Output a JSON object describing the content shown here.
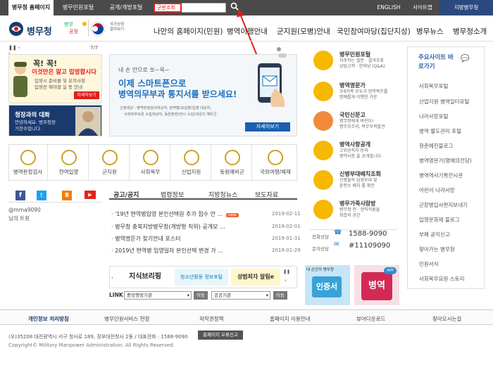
{
  "topbar": {
    "tabs": [
      "병무청 홈페이지",
      "병무민원포털",
      "공개/개방포털"
    ],
    "search_value": "군번조회",
    "links": [
      "ENGLISH",
      "사이트맵",
      "지방병무청"
    ]
  },
  "logo": {
    "text": "병무청",
    "slogan": "국가상징 알아보기"
  },
  "gnb": [
    "나만의 홈페이지(민원)",
    "병역이행안내",
    "군지원(모병)안내",
    "국민참여마당(집단지성)",
    "병무뉴스",
    "병무청소개"
  ],
  "left_slider": {
    "counter": "7/7",
    "title": "꼭! 꼭!",
    "headline": "이것만은 알고 입영합시다",
    "bullets": [
      "입영시 준비물 및 유의사항",
      "입영전 해야할 일 등 안내"
    ],
    "button": "자세히보기"
  },
  "chief": {
    "title": "청장과의 대화",
    "desc": "안녕하세요. 병무청장 기찬수입니다."
  },
  "main_banner": {
    "top": "내 손 안으로 쏘~옥~",
    "line1": "이제 스마트폰으로",
    "line2": "병역의무부과 통지서를 받으세요!",
    "note1": "신청대상 : 병역판정검사대상자, 현역병(모집병)입영 대상자,",
    "note2": "사회복무요원 소집대상자, 동원훈련(전시 소집)대상인 예비군",
    "button": "자세히보기"
  },
  "services": [
    "병역판정검사",
    "현역입영",
    "군지원",
    "사회복무",
    "산업지원",
    "동원예비군",
    "국외여행/체재"
  ],
  "social": {
    "handle": "@mma9090",
    "tweets": "님의 트윗"
  },
  "news": {
    "tabs": [
      "공고/공지",
      "법령정보",
      "지방청뉴스",
      "보도자료"
    ],
    "items": [
      {
        "title": "'19년 현역병입영 본인선택원 추가 접수 안 ...",
        "date": "2019-02-11",
        "is_new": "new"
      },
      {
        "title": "병무청 충북지방병무청(개방형 직위) 공개모 ...",
        "date": "2019-02-01",
        "is_new": ""
      },
      {
        "title": "병역명문가 찾기안내 포스터",
        "date": "2019-01-31",
        "is_new": ""
      },
      {
        "title": "2019년 현역병 입영일자 본인선택 변경 가 ...",
        "date": "2019-01-29",
        "is_new": ""
      }
    ]
  },
  "banners": [
    "지식브리핑",
    "청소년활동 정보포털",
    "성범죄자 알림e"
  ],
  "link_bar": {
    "label": "LINK",
    "select1": "중앙행정기관",
    "btn1": "이동",
    "select2": "공공기관",
    "btn2": "이동"
  },
  "right_panel": [
    {
      "title": "병무민원포털",
      "sub": "자주하는 질문 · 결과조회\n상담고객 · 한마당 (Q&A)"
    },
    {
      "title": "병역명문가",
      "sub": "3대가족 모두가 현역복무를\n명예롭게 이행한 가문"
    },
    {
      "title": "국민신문고",
      "sub": "병무청에게 바란다!\n병무부조리, 복무부적발견"
    },
    {
      "title": "병역사항공개",
      "sub": "고위공직자 등의\n병역사항 을 공개합니다."
    },
    {
      "title": "신병부대배치조회",
      "sub": "신병들의 입영부대 및\n훈련소 배치 를 확인"
    },
    {
      "title": "병무가족사랑방",
      "sub": "병무청 전 · 현직직원들\n화합의 공간"
    }
  ],
  "contacts": {
    "phone_label": "전화상담",
    "phone": "1588-9090",
    "sms_label": "문자상담",
    "sms": "#11109090"
  },
  "apps": [
    "내 손안의 병무청",
    "인증서",
    "병역"
  ],
  "side": {
    "title": "주요사이트 바로가기",
    "items": [
      "사회복무포털",
      "산업지원 병역일터포털",
      "나라사랑포털",
      "병역 별도관리 포털",
      "청춘예찬블로그",
      "병역명문가(명예의전당)",
      "병역역사기록전시관",
      "어린이 나라사랑",
      "군장병입사편지보내기",
      "입영문화제 블로그",
      "부패 공익신고",
      "찾아가는 병무청",
      "민원서식",
      "사회복무요원 스토리"
    ]
  },
  "footer": {
    "links": [
      "개인정보 처리방침",
      "병무민원서비스 헌장",
      "저작권정책",
      "홈페이지 이용안내",
      "뷰어다운로드",
      "찾아오시는길"
    ],
    "address": "(우)35208 대전광역시 서구 청사로 189, 정부대전청사 2동 / 대표전화 : 1588-9090",
    "button": "홈페이지 오류신고",
    "copyright": "Copyright© Military Manpower Administration. All Rights Reserved."
  },
  "colors": {
    "brand": "#1a3a6e",
    "accent": "#e21d1d",
    "topbar": "#4a4a4a"
  }
}
